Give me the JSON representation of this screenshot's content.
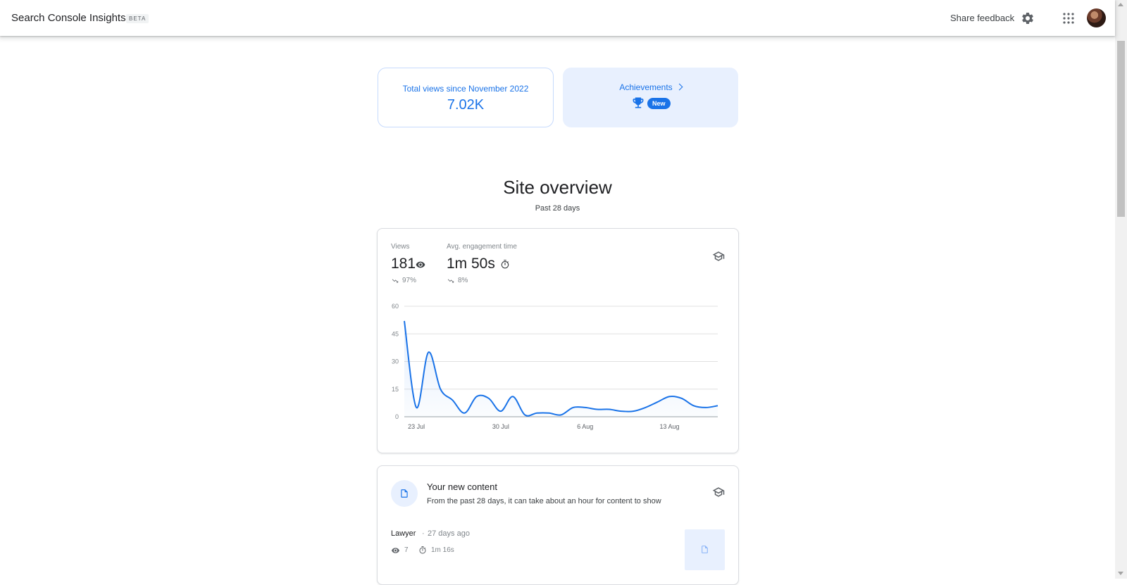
{
  "header": {
    "app_title": "Search Console Insights",
    "beta_label": "BETA",
    "share_feedback": "Share feedback",
    "icons": [
      "gear-icon",
      "apps-grid-icon",
      "avatar"
    ]
  },
  "summary": {
    "total_views_label": "Total views since November 2022",
    "total_views_value": "7.02K",
    "achievements_label": "Achievements",
    "achievements_badge": "New"
  },
  "overview": {
    "title": "Site overview",
    "subtitle": "Past 28 days",
    "views_label": "Views",
    "views_value": "181",
    "views_change": "97%",
    "engagement_label": "Avg. engagement time",
    "engagement_value": "1m 50s",
    "engagement_change": "8%"
  },
  "chart_data": {
    "type": "line",
    "title": "",
    "xlabel": "",
    "ylabel": "",
    "ylim": [
      0,
      60
    ],
    "yticks": [
      0,
      15,
      30,
      45,
      60
    ],
    "xtick_labels": [
      "23 Jul",
      "30 Jul",
      "6 Aug",
      "13 Aug"
    ],
    "grid": true,
    "series": [
      {
        "x": [
          0,
          1,
          2,
          3,
          4,
          5,
          6,
          7,
          8,
          9,
          10,
          11,
          12,
          13,
          14,
          15,
          16,
          17,
          18,
          19,
          20,
          21,
          22,
          23,
          24,
          25,
          26
        ],
        "values": [
          52,
          5,
          35,
          15,
          9,
          2,
          11,
          10,
          3,
          11,
          1,
          2,
          2,
          1,
          5,
          5,
          4,
          4,
          3,
          3,
          5,
          8,
          11,
          10,
          6,
          5,
          6
        ]
      }
    ],
    "color": "#1a73e8",
    "xtick_positions": [
      1,
      8,
      15,
      22
    ]
  },
  "new_content": {
    "title": "Your new content",
    "description": "From the past 28 days, it can take about an hour for content to show",
    "items": [
      {
        "title": "Lawyer",
        "age": "27 days ago",
        "views": "7",
        "time": "1m 16s"
      }
    ]
  }
}
